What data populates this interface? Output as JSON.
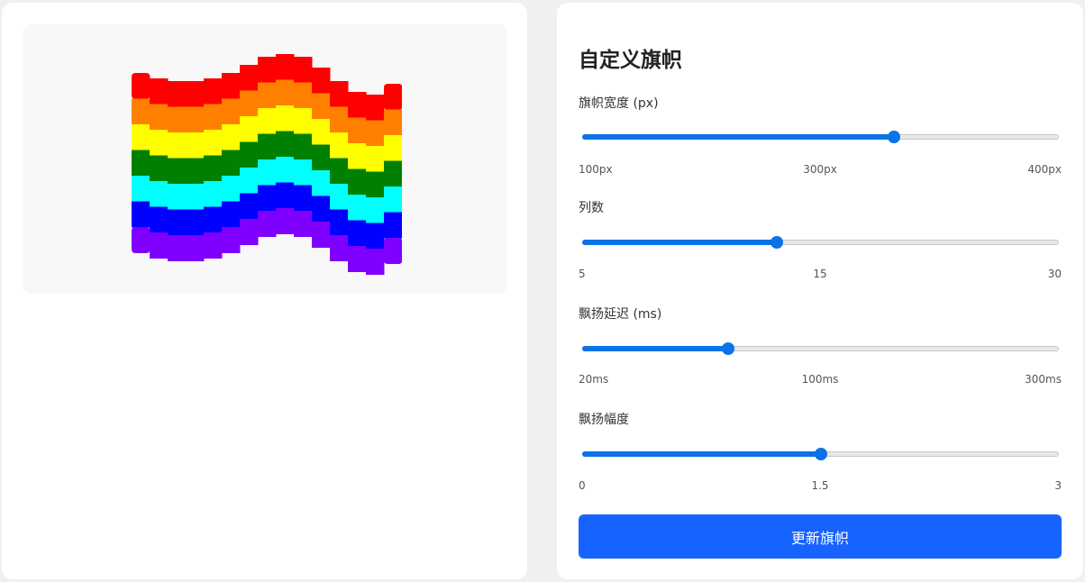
{
  "panel": {
    "title": "自定义旗帜",
    "controls": [
      {
        "label": "旗帜宽度 (px)",
        "min_label": "100px",
        "mid_label": "300px",
        "max_label": "400px",
        "value_fraction": 0.655
      },
      {
        "label": "列数",
        "min_label": "5",
        "mid_label": "15",
        "max_label": "30",
        "value_fraction": 0.408
      },
      {
        "label": "飘扬延迟 (ms)",
        "min_label": "20ms",
        "mid_label": "100ms",
        "max_label": "300ms",
        "value_fraction": 0.305
      },
      {
        "label": "飘扬幅度",
        "min_label": "0",
        "mid_label": "1.5",
        "max_label": "3",
        "value_fraction": 0.5
      }
    ],
    "update_button": "更新旗帜"
  },
  "flag": {
    "stripe_colors": [
      "#ff0000",
      "#ff8000",
      "#ffff00",
      "#008000",
      "#00ffff",
      "#0000ff",
      "#8000ff"
    ],
    "column_count": 15,
    "column_offsets": [
      0,
      2,
      3,
      3,
      2,
      0,
      -3,
      -6,
      -7,
      -6,
      -2,
      3,
      7,
      8,
      4
    ]
  },
  "colors": {
    "accent": "#0b72e7",
    "button": "#1763ff"
  }
}
